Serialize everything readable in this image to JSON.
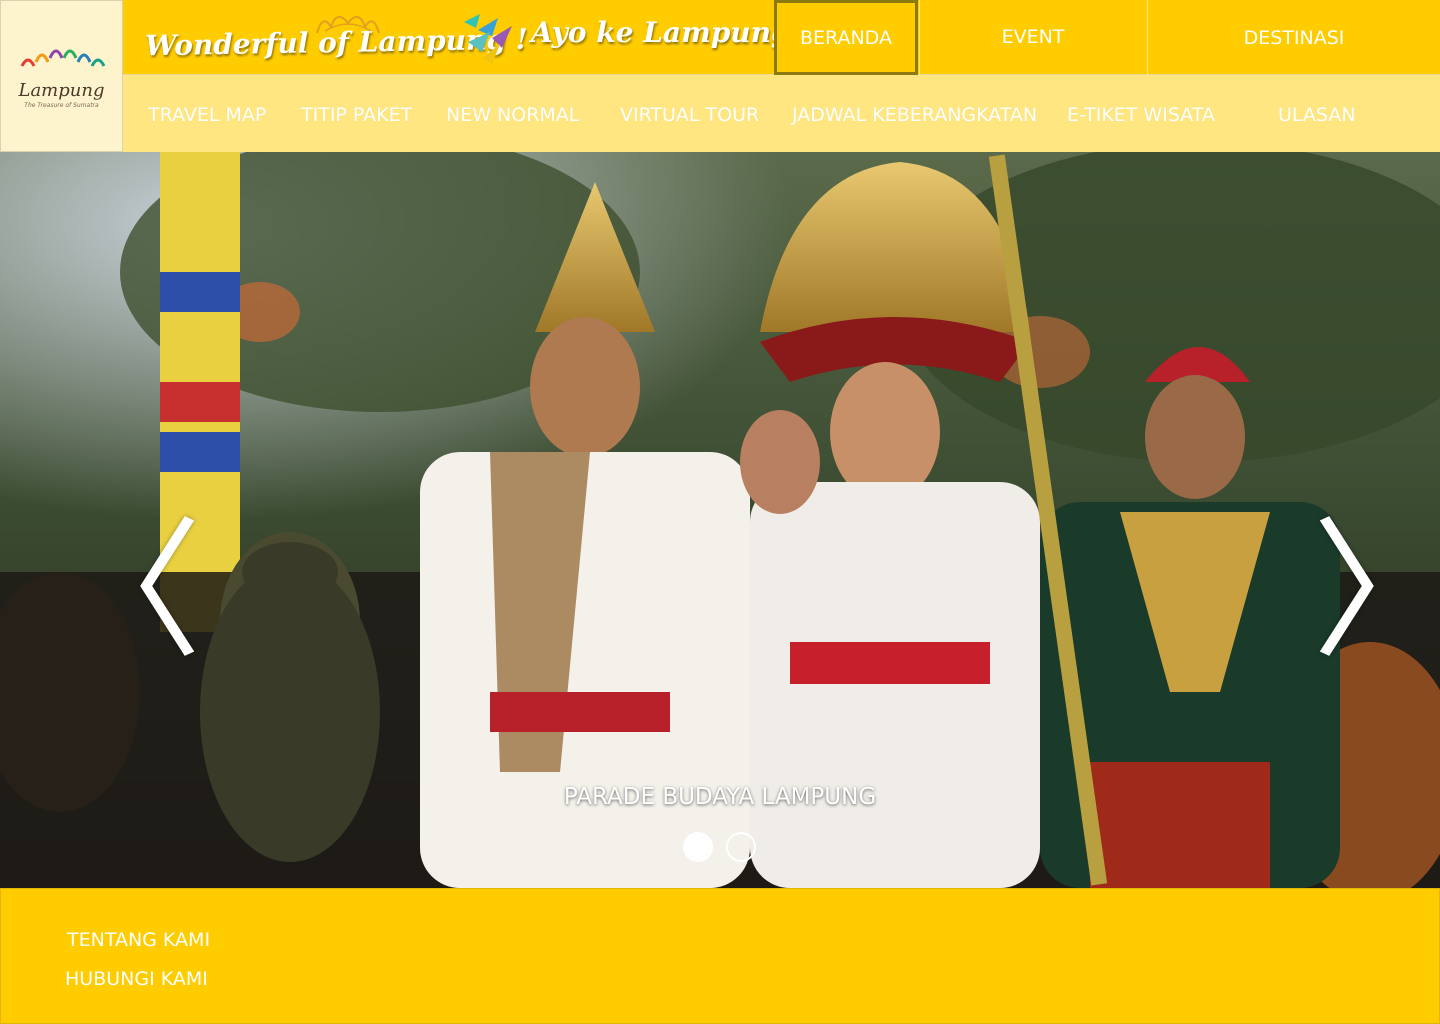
{
  "brand": {
    "logo_name": "Lampung",
    "logo_tagline": "The Treasure of Sumatra",
    "slogan_primary": "Wonderful of Lampung !",
    "slogan_secondary": "Ayo ke Lampung !"
  },
  "nav_primary": [
    {
      "label": "BERANDA",
      "active": true
    },
    {
      "label": "EVENT",
      "active": false
    },
    {
      "label": "DESTINASI",
      "active": false
    }
  ],
  "nav_secondary": [
    {
      "label": "TRAVEL MAP"
    },
    {
      "label": "TITIP PAKET"
    },
    {
      "label": "NEW NORMAL"
    },
    {
      "label": "VIRTUAL TOUR"
    },
    {
      "label": "JADWAL KEBERANGKATAN"
    },
    {
      "label": "E-TIKET WISATA"
    },
    {
      "label": "ULASAN"
    }
  ],
  "carousel": {
    "caption": "PARADE BUDAYA LAMPUNG",
    "prev_glyph": "〈",
    "next_glyph": "〉",
    "slide_count": 2,
    "active_slide": 1
  },
  "footer": {
    "links": [
      {
        "label": "TENTANG KAMI"
      },
      {
        "label": "HUBUNGI KAMI"
      }
    ]
  },
  "colors": {
    "primary_yellow": "#ffcc00",
    "light_yellow": "#ffe680",
    "logo_bg": "#fdf3cc",
    "active_border": "#8a7a10"
  }
}
